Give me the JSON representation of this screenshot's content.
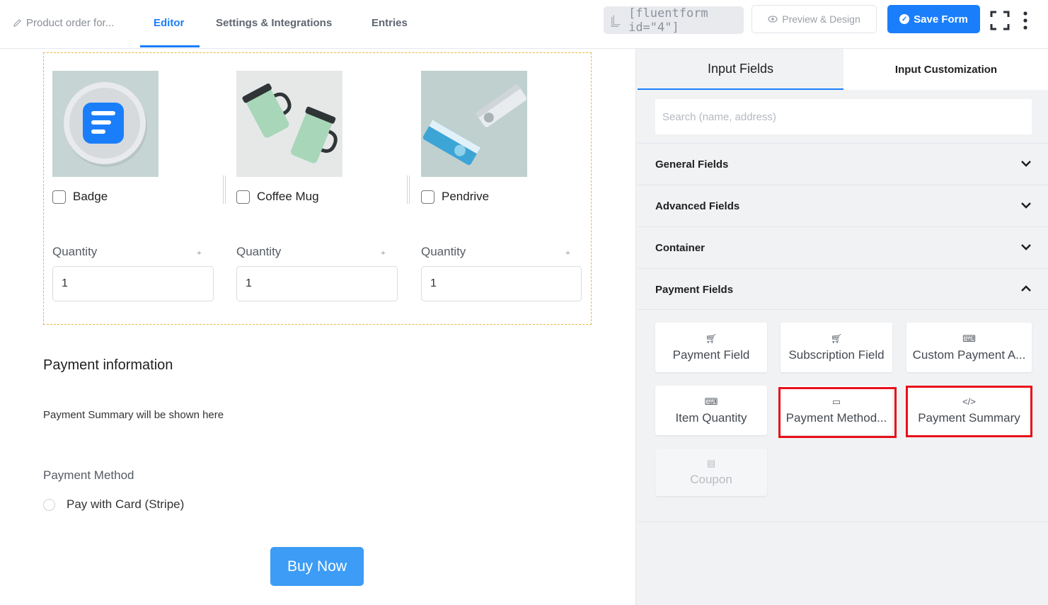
{
  "header": {
    "form_title": "Product order for...",
    "tabs": [
      "Editor",
      "Settings & Integrations",
      "Entries"
    ],
    "active_tab": "Editor",
    "shortcode": "[fluentform id=\"4\"]",
    "preview_label": "Preview & Design",
    "save_label": "Save Form"
  },
  "products": [
    {
      "name": "Badge",
      "quantity_label": "Quantity",
      "quantity_value": "1"
    },
    {
      "name": "Coffee Mug",
      "quantity_label": "Quantity",
      "quantity_value": "1"
    },
    {
      "name": "Pendrive",
      "quantity_label": "Quantity",
      "quantity_value": "1"
    }
  ],
  "payment": {
    "heading": "Payment information",
    "summary_text": "Payment Summary will be shown here",
    "method_label": "Payment Method",
    "method_option": "Pay with Card (Stripe)",
    "submit_label": "Buy Now"
  },
  "sidebar": {
    "tabs": [
      "Input Fields",
      "Input Customization"
    ],
    "search_placeholder": "Search (name, address)",
    "sections": [
      "General Fields",
      "Advanced Fields",
      "Container",
      "Payment Fields"
    ],
    "payment_fields": [
      {
        "label": "Payment Field",
        "icon": "cart-icon"
      },
      {
        "label": "Subscription Field",
        "icon": "cart-icon"
      },
      {
        "label": "Custom Payment A...",
        "icon": "keyboard-icon"
      },
      {
        "label": "Item Quantity",
        "icon": "keyboard-icon"
      },
      {
        "label": "Payment Method...",
        "icon": "credit-card-icon"
      },
      {
        "label": "Payment Summary",
        "icon": "code-icon"
      },
      {
        "label": "Coupon",
        "icon": "coupon-icon"
      }
    ]
  },
  "colors": {
    "accent": "#1a7efb",
    "highlight": "#e8101a",
    "selected_border": "#e6b93b",
    "buy_button": "#3c9cf6"
  }
}
